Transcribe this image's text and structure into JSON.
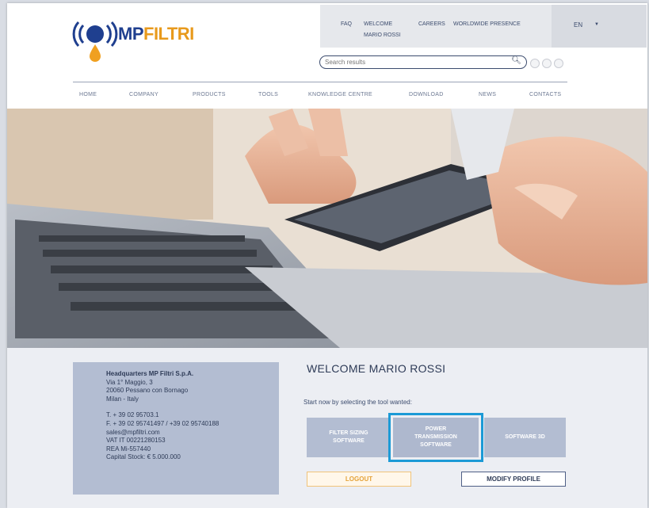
{
  "header": {
    "logo": {
      "text_mp": "MP",
      "text_filtri": "FILTRI"
    },
    "top_links": [
      "FAQ",
      "WELCOME",
      "MARIO ROSSI",
      "CAREERS",
      "WORLDWIDE PRESENCE"
    ],
    "language": "EN",
    "search_placeholder": "Search results",
    "nav": [
      "HOME",
      "COMPANY",
      "PRODUCTS",
      "TOOLS",
      "KNOWLEDGE CENTRE",
      "DOWNLOAD",
      "NEWS",
      "CONTACTS"
    ]
  },
  "hq": {
    "title": "Headquarters MP Filtri S.p.A.",
    "address1": "Via 1° Maggio, 3",
    "address2": "20060 Pessano con Bornago",
    "address3": "Milan - Italy",
    "phone": "T.  + 39 02 95703.1",
    "fax": "F.  + 39 02 95741497 / +39 02 95740188",
    "email": "sales@mpfiltri.com",
    "vat": "VAT IT 00221280153",
    "rea": "REA Mi-557440",
    "capital": "Capital Stock: € 5.000.000"
  },
  "main": {
    "welcome": "WELCOME MARIO ROSSI",
    "start_text": "Start now by selecting the tool wanted:",
    "tools": [
      {
        "line1": "FILTER SIZING",
        "line2": "SOFTWARE",
        "line3": ""
      },
      {
        "line1": "POWER",
        "line2": "TRANSMISSION",
        "line3": "SOFTWARE"
      },
      {
        "line1": "SOFTWARE 3D",
        "line2": "",
        "line3": ""
      }
    ],
    "logout": "LOGOUT",
    "modify_profile": "MODIFY PROFILE"
  },
  "colors": {
    "brand_blue": "#1f3f8f",
    "brand_orange": "#e89a1c",
    "highlight": "#1c9ad6",
    "panel": "#b3bdd2"
  },
  "icons": [
    "mp-filtri-logo",
    "search-icon",
    "chevron-down-icon",
    "social-icon"
  ]
}
